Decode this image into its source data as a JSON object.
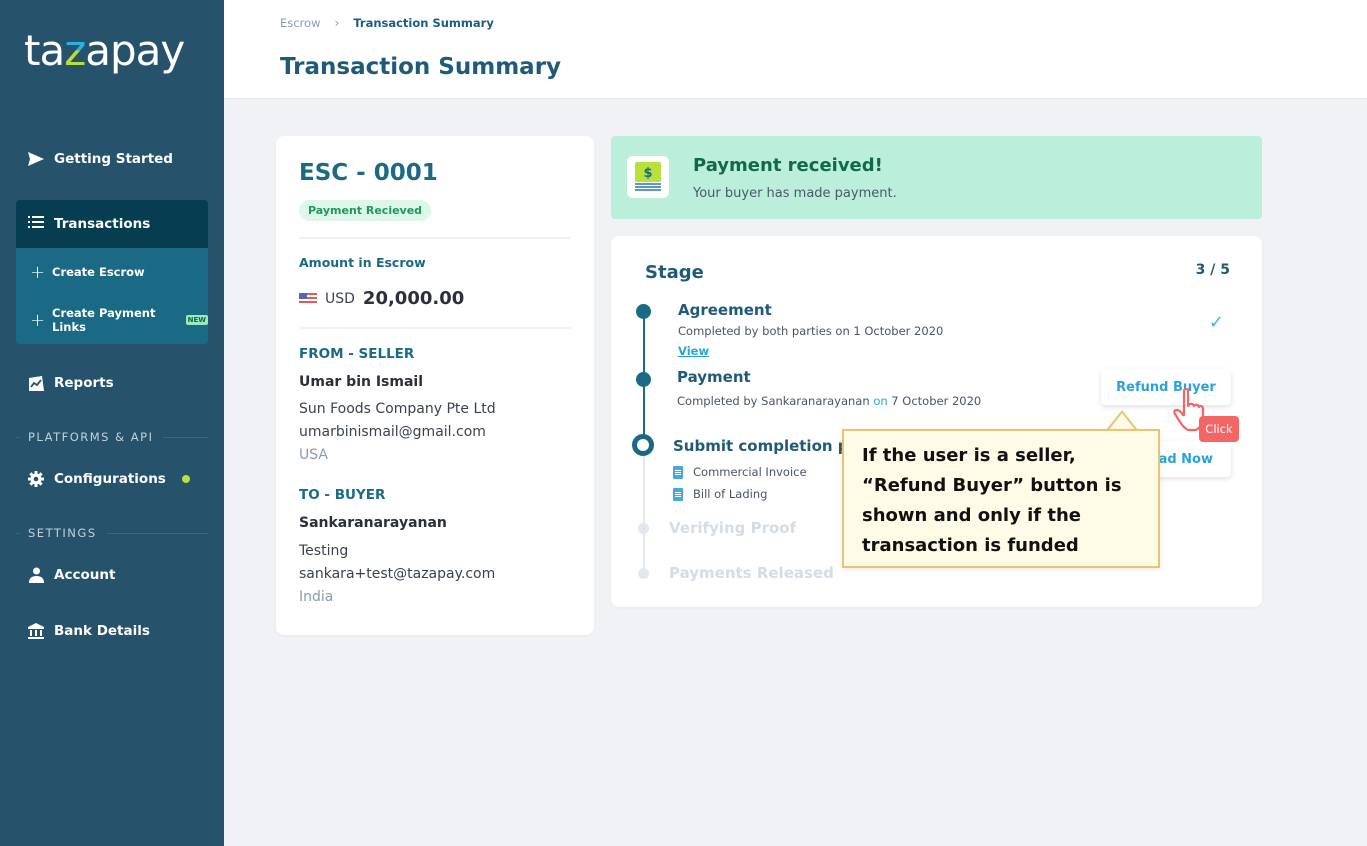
{
  "brand": {
    "logo_pre": "ta",
    "logo_z": "z",
    "logo_post": "apay"
  },
  "sidebar": {
    "getting_started": "Getting Started",
    "transactions": {
      "label": "Transactions",
      "sub": [
        {
          "label": "Create Escrow",
          "badge": ""
        },
        {
          "label": "Create Payment Links",
          "badge": "NEW"
        }
      ]
    },
    "reports": "Reports",
    "section_platforms": "PLATFORMS & API",
    "configurations": "Configurations",
    "section_settings": "SETTINGS",
    "account": "Account",
    "bank_details": "Bank Details",
    "colors": {
      "bg": "#26526b",
      "active": "#063d51",
      "group": "#1a6a85",
      "status_dot": "#b8e23a"
    }
  },
  "header": {
    "breadcrumb": [
      "Escrow",
      "Transaction Summary"
    ],
    "title": "Transaction Summary"
  },
  "summary": {
    "id": "ESC - 0001",
    "status": "Payment Recieved",
    "amount_label": "Amount in Escrow",
    "currency": "USD",
    "amount": "20,000.00",
    "seller": {
      "heading": "FROM - SELLER",
      "name": "Umar bin Ismail",
      "company": "Sun Foods Company Pte Ltd",
      "email": "umarbinismail@gmail.com",
      "country": "USA"
    },
    "buyer": {
      "heading": "TO - BUYER",
      "name": "Sankaranarayanan",
      "company": "Testing",
      "email": "sankara+test@tazapay.com",
      "country": "India"
    }
  },
  "banner": {
    "title": "Payment received!",
    "subtitle": "Your buyer has made payment.",
    "icon": "money-stack-icon",
    "color": "#bbeedb"
  },
  "stage": {
    "title": "Stage",
    "current": 3,
    "total": 5,
    "count_label": "3 / 5",
    "steps": [
      {
        "title": "Agreement",
        "desc": "Completed by both parties on 1 October 2020",
        "link": "View",
        "state": "done"
      },
      {
        "title": "Payment",
        "desc_pre": "Completed by Sankaranarayanan ",
        "desc_on": "on",
        "desc_post": " 7 October 2020",
        "state": "done",
        "action": "Refund Buyer"
      },
      {
        "title": "Submit completion proof",
        "title_visible": "Submit completion pro",
        "docs": [
          "Commercial Invoice",
          "Bill of Lading"
        ],
        "state": "current",
        "action": "Upload Now",
        "action_visible": "oad Now"
      },
      {
        "title": "Verifying Proof",
        "state": "pending"
      },
      {
        "title": "Payments Released",
        "state": "pending"
      }
    ]
  },
  "annotation": {
    "text": "If the user is a seller, “Refund Buyer” button is shown and only if the transaction is funded",
    "click_label": "Click"
  }
}
